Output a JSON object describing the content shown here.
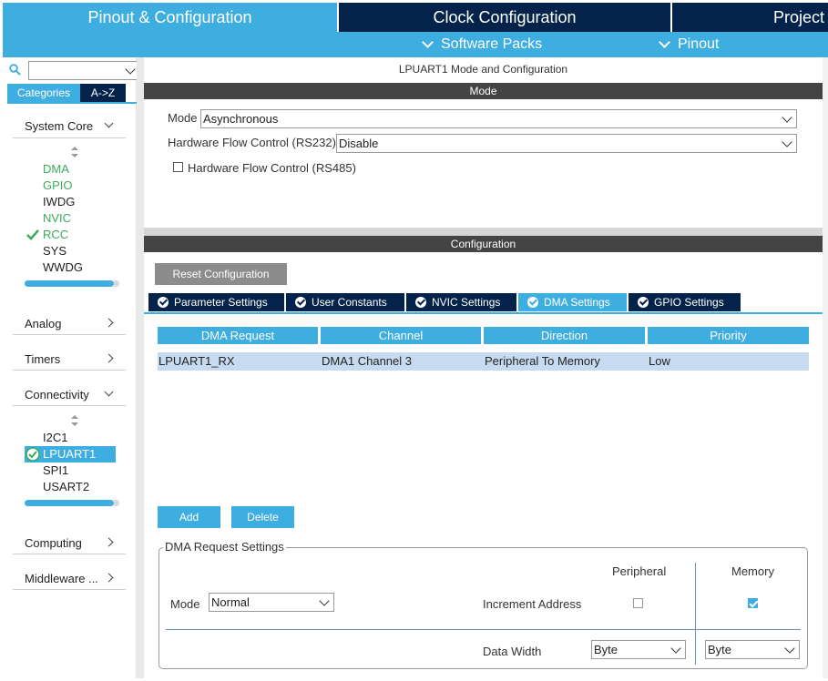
{
  "top_tabs": {
    "pinout_config": "Pinout & Configuration",
    "clock_config": "Clock Configuration",
    "project": "Project"
  },
  "sub_menu": {
    "software_packs": "Software Packs",
    "pinout": "Pinout"
  },
  "sidebar": {
    "search_value": "",
    "tab_categories": "Categories",
    "tab_az": "A->Z",
    "system_core": {
      "label": "System Core",
      "items": [
        "DMA",
        "GPIO",
        "IWDG",
        "NVIC",
        "RCC",
        "SYS",
        "WWDG"
      ]
    },
    "analog": "Analog",
    "timers": "Timers",
    "connectivity": {
      "label": "Connectivity",
      "items": [
        "I2C1",
        "LPUART1",
        "SPI1",
        "USART2"
      ]
    },
    "computing": "Computing",
    "middleware": "Middleware ..."
  },
  "main": {
    "title": "LPUART1 Mode and Configuration",
    "mode_bar": "Mode",
    "mode_label": "Mode",
    "mode_value": "Asynchronous",
    "hfc_rs232_label": "Hardware Flow Control (RS232)",
    "hfc_rs232_value": "Disable",
    "hfc_rs485_label": "Hardware Flow Control (RS485)",
    "config_bar": "Configuration",
    "reset_button": "Reset Configuration",
    "tabs": [
      "Parameter Settings",
      "User Constants",
      "NVIC Settings",
      "DMA Settings",
      "GPIO Settings"
    ],
    "table": {
      "headers": [
        "DMA Request",
        "Channel",
        "Direction",
        "Priority"
      ],
      "rows": [
        [
          "LPUART1_RX",
          "DMA1 Channel 3",
          "Peripheral To Memory",
          "Low"
        ]
      ]
    },
    "add_button": "Add",
    "delete_button": "Delete",
    "dma_settings": {
      "legend": "DMA Request Settings",
      "peripheral_header": "Peripheral",
      "memory_header": "Memory",
      "mode_label": "Mode",
      "mode_value": "Normal",
      "increment_label": "Increment Address",
      "peripheral_increment": false,
      "memory_increment": true,
      "data_width_label": "Data Width",
      "peripheral_width": "Byte",
      "memory_width": "Byte"
    }
  },
  "colors": {
    "accent": "#3eaee0",
    "navy": "#03234b",
    "green": "#3caa5c",
    "row_selected": "#c6dbef"
  }
}
